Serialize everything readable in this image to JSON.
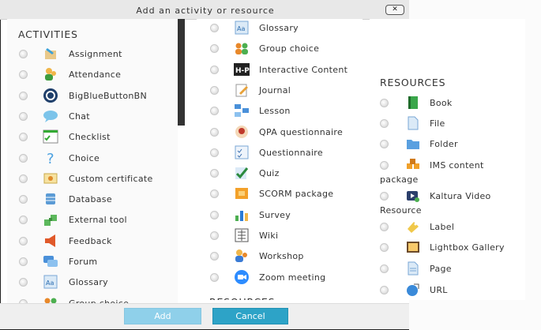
{
  "dialog": {
    "title": "Add an activity or resource",
    "close_label": "✕"
  },
  "activities": {
    "heading": "ACTIVITIES",
    "items": [
      {
        "label": "Assignment",
        "icon": "assignment-icon"
      },
      {
        "label": "Attendance",
        "icon": "attendance-icon"
      },
      {
        "label": "BigBlueButtonBN",
        "icon": "bigbluebutton-icon"
      },
      {
        "label": "Chat",
        "icon": "chat-icon"
      },
      {
        "label": "Checklist",
        "icon": "checklist-icon"
      },
      {
        "label": "Choice",
        "icon": "choice-icon"
      },
      {
        "label": "Custom certificate",
        "icon": "certificate-icon"
      },
      {
        "label": "Database",
        "icon": "database-icon"
      },
      {
        "label": "External tool",
        "icon": "external-tool-icon"
      },
      {
        "label": "Feedback",
        "icon": "feedback-icon"
      },
      {
        "label": "Forum",
        "icon": "forum-icon"
      },
      {
        "label": "Glossary",
        "icon": "glossary-icon"
      },
      {
        "label": "Group choice",
        "icon": "group-choice-icon"
      }
    ]
  },
  "activities_cont": {
    "items": [
      {
        "label": "Glossary",
        "icon": "glossary-icon"
      },
      {
        "label": "Group choice",
        "icon": "group-choice-icon"
      },
      {
        "label": "Interactive Content",
        "icon": "h5p-icon",
        "icon_text": "H-P"
      },
      {
        "label": "Journal",
        "icon": "journal-icon"
      },
      {
        "label": "Lesson",
        "icon": "lesson-icon"
      },
      {
        "label": "QPA questionnaire",
        "icon": "qpa-icon"
      },
      {
        "label": "Questionnaire",
        "icon": "questionnaire-icon"
      },
      {
        "label": "Quiz",
        "icon": "quiz-icon"
      },
      {
        "label": "SCORM package",
        "icon": "scorm-icon"
      },
      {
        "label": "Survey",
        "icon": "survey-icon"
      },
      {
        "label": "Wiki",
        "icon": "wiki-icon"
      },
      {
        "label": "Workshop",
        "icon": "workshop-icon"
      },
      {
        "label": "Zoom meeting",
        "icon": "zoom-icon"
      }
    ],
    "next_heading": "RESOURCES"
  },
  "resources": {
    "heading": "RESOURCES",
    "items": [
      {
        "label": "Book",
        "label2": "",
        "icon": "book-icon"
      },
      {
        "label": "File",
        "label2": "",
        "icon": "file-icon"
      },
      {
        "label": "Folder",
        "label2": "",
        "icon": "folder-icon"
      },
      {
        "label": "IMS content",
        "label2": "package",
        "icon": "ims-icon"
      },
      {
        "label": "Kaltura Video",
        "label2": "Resource",
        "icon": "kaltura-icon"
      },
      {
        "label": "Label",
        "label2": "",
        "icon": "label-icon"
      },
      {
        "label": "Lightbox Gallery",
        "label2": "",
        "icon": "gallery-icon"
      },
      {
        "label": "Page",
        "label2": "",
        "icon": "page-icon"
      },
      {
        "label": "URL",
        "label2": "",
        "icon": "url-icon"
      }
    ]
  },
  "footer": {
    "add_label": "Add",
    "cancel_label": "Cancel"
  },
  "colors": {
    "add_button": "#8fd0ea",
    "cancel_button": "#2da3c7"
  }
}
